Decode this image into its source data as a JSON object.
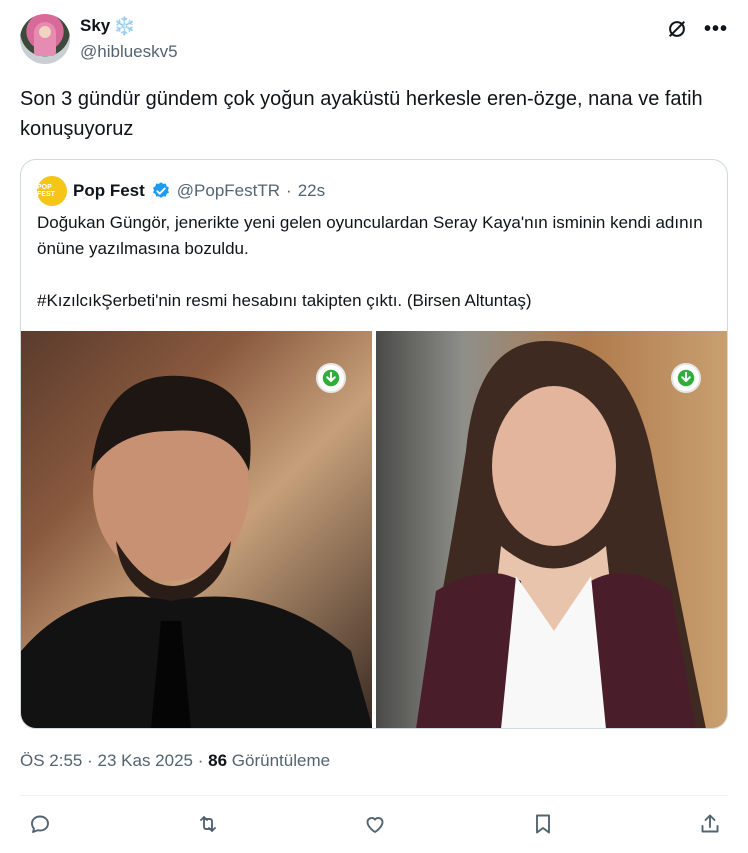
{
  "author": {
    "display_name": "Sky",
    "name_emoji": "❄️",
    "handle": "@hiblueskv5"
  },
  "tweet": {
    "text": "Son 3 gündür gündem çok yoğun ayaküstü herkesle eren-özge,  nana ve fatih konuşuyoruz"
  },
  "quote": {
    "avatar_text": "POP FEST",
    "display_name": "Pop Fest",
    "handle": "@PopFestTR",
    "separator": "·",
    "time": "22s",
    "text": "Doğukan Güngör, jenerikte yeni gelen oyunculardan Seray Kaya'nın isminin kendi adının önüne yazılmasına bozuldu.\n\n#KızılcıkŞerbeti'nin resmi hesabını takipten çıktı. (Birsen Altuntaş)"
  },
  "meta": {
    "time": "ÖS 2:55",
    "sep1": "·",
    "date": "23 Kas 2025",
    "sep2": "·",
    "views_count": "86",
    "views_label": "Görüntüleme"
  },
  "icons": {
    "grok": "grok-icon",
    "more": "more-icon",
    "verified": "verified-badge-icon",
    "download": "download-icon",
    "reply": "reply-icon",
    "retweet": "retweet-icon",
    "like": "like-icon",
    "bookmark": "bookmark-icon",
    "share": "share-icon"
  },
  "colors": {
    "text": "#0f1419",
    "secondary": "#536471",
    "border": "#cfd9de",
    "verified": "#1d9bf0",
    "download": "#2fae3c"
  }
}
